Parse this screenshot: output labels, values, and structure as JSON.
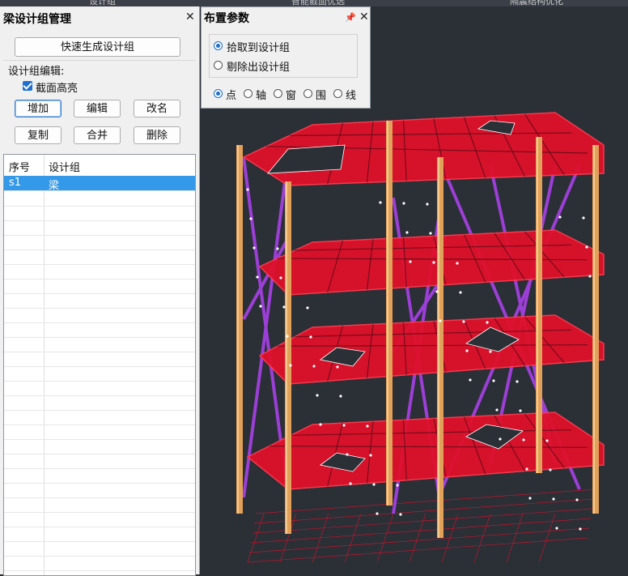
{
  "top_strip": {
    "items": [
      "设计组",
      "智能截面优选",
      "隔震结构优化"
    ]
  },
  "left_panel": {
    "title": "梁设计组管理",
    "quick_generate": "快速生成设计组",
    "edit_label": "设计组编辑:",
    "section_height_checkbox": {
      "label": "截面高亮",
      "checked": true
    },
    "buttons": [
      "增加",
      "编辑",
      "改名",
      "复制",
      "合并",
      "删除"
    ],
    "table": {
      "headers": [
        "序号",
        "设计组"
      ],
      "rows": [
        {
          "id": "s1",
          "name": "梁",
          "selected": true
        }
      ]
    }
  },
  "right_panel": {
    "title": "布置参数",
    "pin_icon": "pin-icon",
    "mode_options": [
      {
        "label": "拾取到设计组",
        "selected": true
      },
      {
        "label": "剔除出设计组",
        "selected": false
      }
    ],
    "select_modes": [
      {
        "label": "点",
        "selected": true
      },
      {
        "label": "轴",
        "selected": false
      },
      {
        "label": "窗",
        "selected": false
      },
      {
        "label": "围",
        "selected": false
      },
      {
        "label": "线",
        "selected": false
      }
    ]
  },
  "colors": {
    "accent": "#1e6fd0",
    "selection": "#3399e8",
    "beam": "#e0102a",
    "column": "#e2a15a",
    "brace": "#9b3fd6",
    "viewport_bg": "#2b2f36"
  }
}
